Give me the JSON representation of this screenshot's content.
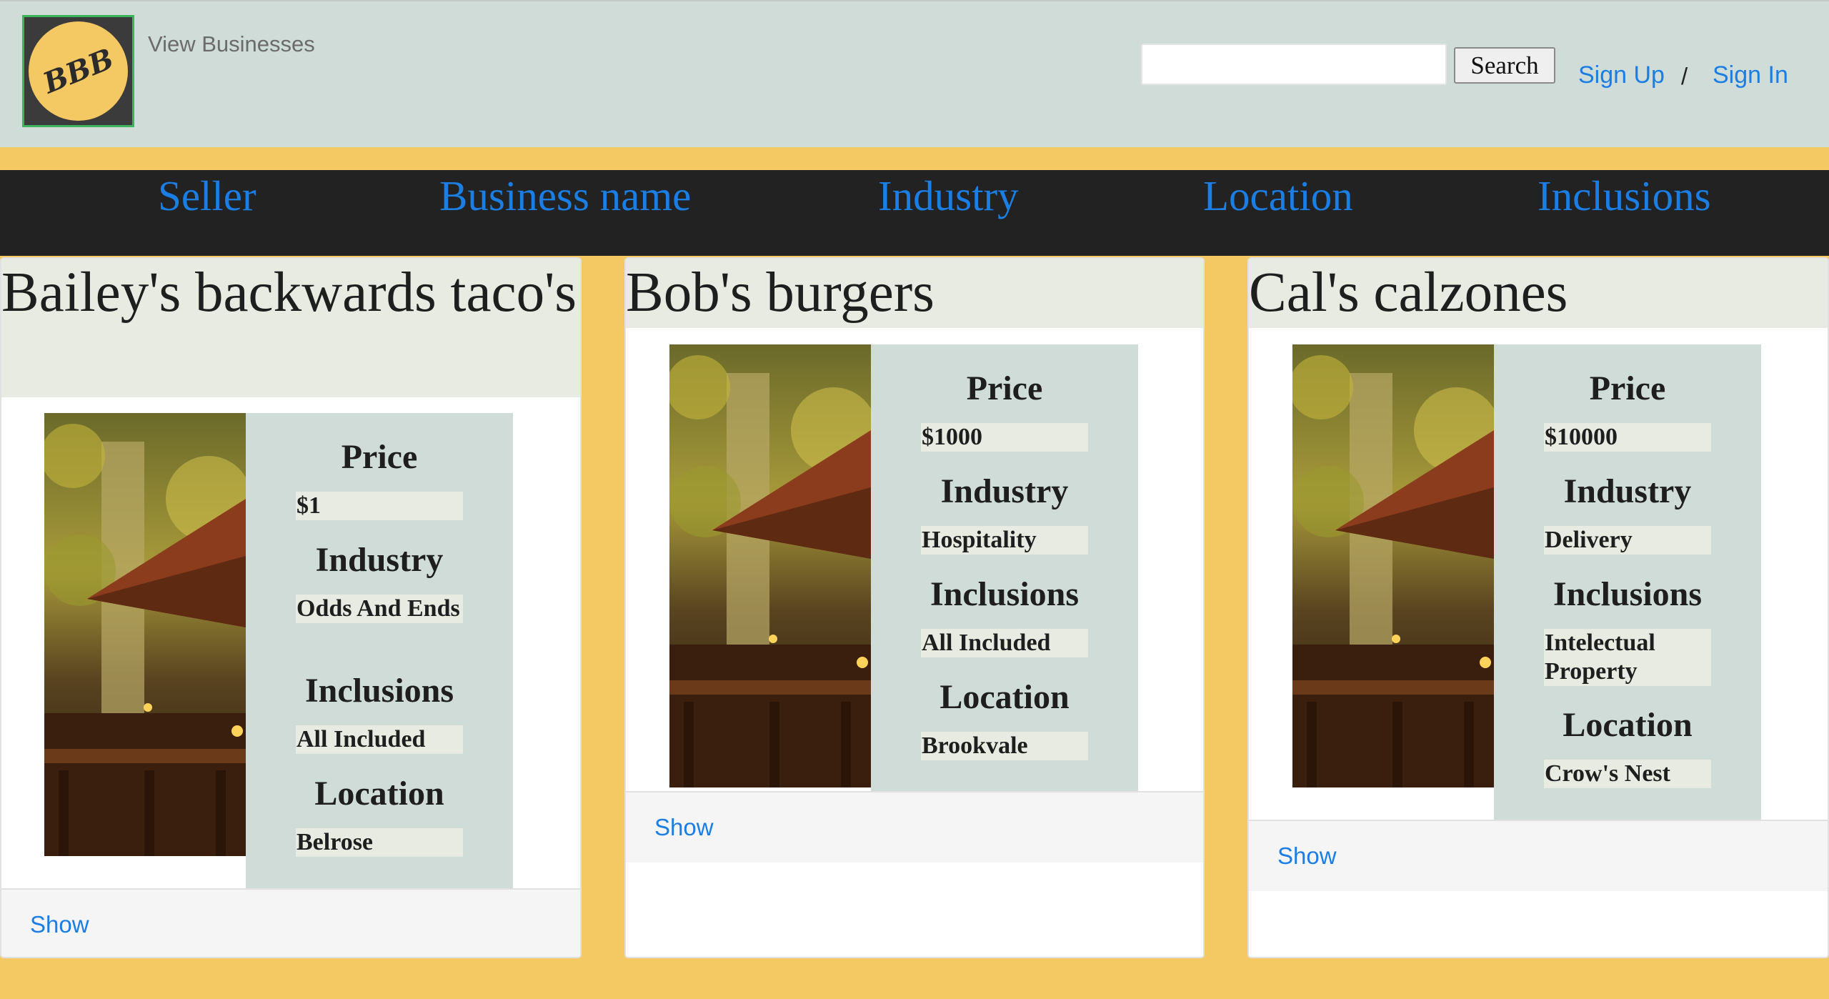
{
  "header": {
    "logo_text": "BBB",
    "view_businesses": "View Businesses",
    "search": {
      "value": "",
      "placeholder": "",
      "button_label": "Search"
    },
    "sign_up": "Sign Up",
    "separator": "/",
    "sign_in": "Sign In"
  },
  "nav": {
    "items": [
      "Seller",
      "Business name",
      "Industry",
      "Location",
      "Inclusions"
    ]
  },
  "labels": {
    "price": "Price",
    "industry": "Industry",
    "inclusions": "Inclusions",
    "location": "Location",
    "show": "Show"
  },
  "listings": [
    {
      "title": "Bailey's backwards taco's",
      "price": "$1",
      "industry": "Odds And Ends",
      "inclusions": "All Included",
      "location": "Belrose"
    },
    {
      "title": "Bob's burgers",
      "price": "$1000",
      "industry": "Hospitality",
      "inclusions": "All Included",
      "location": "Brookvale"
    },
    {
      "title": "Cal's calzones",
      "price": "$10000",
      "industry": "Delivery",
      "inclusions": "Intelectual Property",
      "location": "Crow's Nest"
    }
  ],
  "colors": {
    "page_background": "#f4c862",
    "header_background": "#cfdcd7",
    "nav_background": "#222222",
    "link": "#1a7ee4",
    "card_title_background": "#e7ebe1",
    "details_background": "#cfdcd7",
    "value_background": "#e7ebe1"
  },
  "icons": {
    "listing_image": "restaurant-patio-photo"
  }
}
